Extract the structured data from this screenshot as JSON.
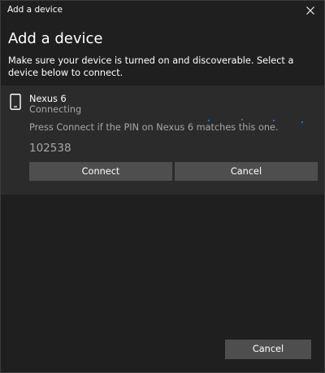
{
  "window": {
    "title": "Add a device"
  },
  "heading": "Add a device",
  "instructions": "Make sure your device is turned on and discoverable. Select a device below to connect.",
  "device": {
    "icon": "phone-icon",
    "name": "Nexus 6",
    "status": "Connecting",
    "pin_message": "Press Connect if the PIN on Nexus 6 matches this one.",
    "pin": "102538",
    "connect_label": "Connect",
    "cancel_label": "Cancel"
  },
  "footer": {
    "cancel_label": "Cancel"
  },
  "colors": {
    "background": "#1f1f1f",
    "panel": "#2b2b2b",
    "button": "#4e4e4e",
    "secondary_text": "#a6a6a6",
    "progress_dots": "#2f6fb5"
  }
}
